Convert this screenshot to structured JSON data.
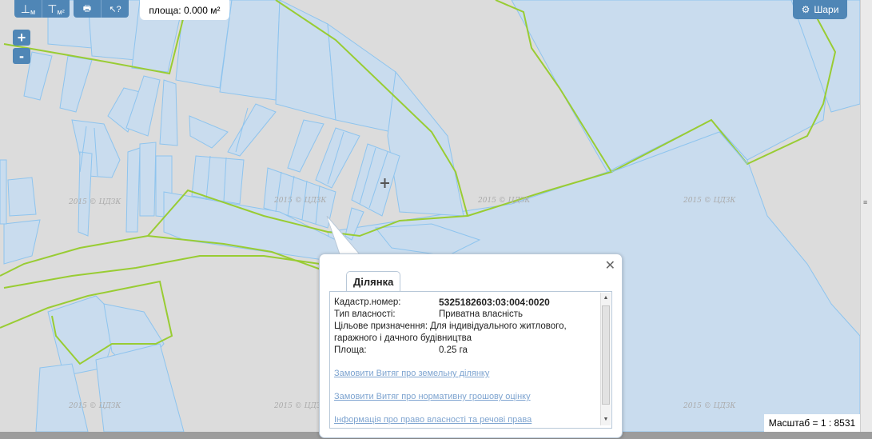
{
  "toolbar": {
    "measure_length_label": "м",
    "measure_area_label": "м²",
    "print_icon": "print-icon",
    "info_icon": "identify-icon"
  },
  "area_readout": "площа: 0.000 м²",
  "zoom": {
    "in": "+",
    "out": "-"
  },
  "layers_button": "Шари",
  "watermark": "2015 © ЦДЗК",
  "scale": "Масштаб = 1 : 8531",
  "popup": {
    "tab": "Ділянка",
    "fields": [
      {
        "key": "Кадастр.номер:",
        "value": "5325182603:03:004:0020"
      },
      {
        "key": "Тип власності:",
        "value": "Приватна власність"
      },
      {
        "key": "Цільове призначення:",
        "value": "Для індивідуального житлового, гаражного і дачного будівництва"
      },
      {
        "key": "Площа:",
        "value": "0.25 га"
      }
    ],
    "links": [
      "Замовити Витяг про земельну ділянку",
      "Замовити Витяг про нормативну грошову оцінку",
      "Інформація про право власності та речові права"
    ]
  },
  "colors": {
    "parcel_fill": "#c9dcee",
    "parcel_stroke": "#8ec4ee",
    "boundary": "#99cc33",
    "ui_blue": "#4f86b6",
    "map_bg": "#dcdcdc"
  }
}
